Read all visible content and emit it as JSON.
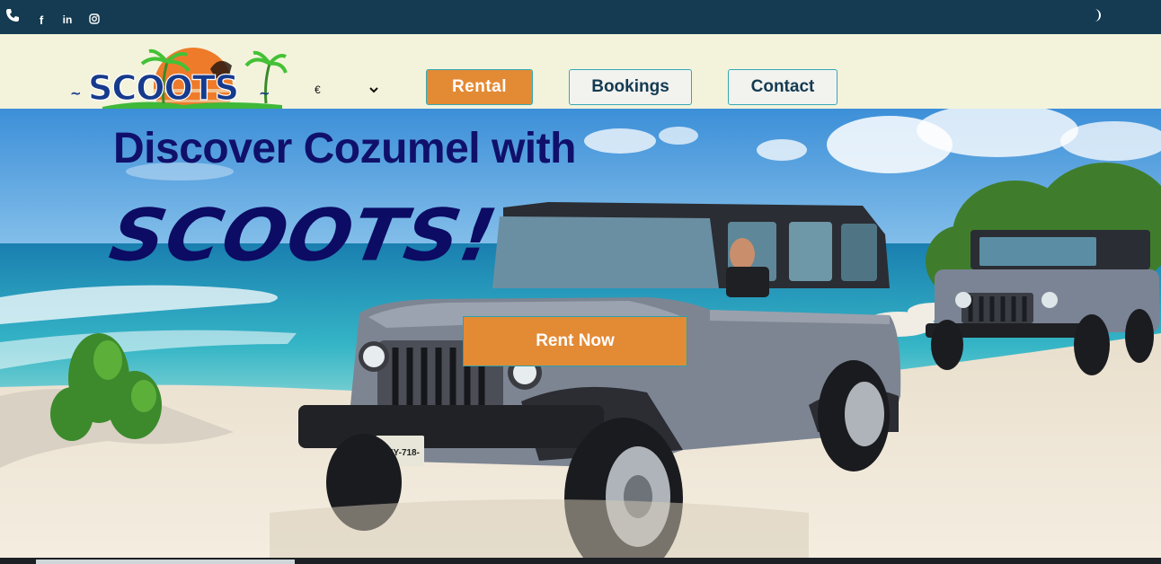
{
  "topbar": {
    "icons": [
      "phone-icon",
      "facebook-icon",
      "linkedin-icon",
      "instagram-icon",
      "moon-icon"
    ],
    "facebook_glyph": "f",
    "linkedin_glyph": "in"
  },
  "header": {
    "logo_text": "SCOOTS",
    "currency": {
      "selected": "€"
    },
    "nav": {
      "rental": "Rental",
      "bookings": "Bookings",
      "contact": "Contact"
    }
  },
  "hero": {
    "title": "Discover Cozumel with",
    "brand": "SCOOTS!",
    "cta": "Rent Now",
    "plate": "DNY-718-"
  },
  "colors": {
    "topbar": "#143b52",
    "header_bg": "#f3f3dc",
    "accent_orange": "#e38a35",
    "button_border": "#35a8b4",
    "title_navy": "#10106b"
  }
}
